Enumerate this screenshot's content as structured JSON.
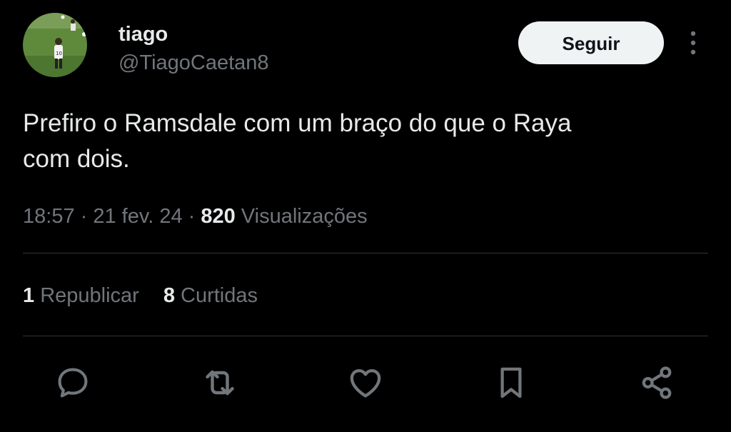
{
  "author": {
    "display_name": "tiago",
    "handle": "@TiagoCaetan8"
  },
  "follow_button": {
    "label": "Seguir"
  },
  "tweet": {
    "text_line1": "Prefiro o Ramsdale com um braço do que o Raya",
    "text_line2": "com dois."
  },
  "meta": {
    "time": "18:57",
    "separator": " · ",
    "date": "21 fev. 24",
    "views_count": "820",
    "views_label": " Visualizações"
  },
  "stats": {
    "reposts_count": "1",
    "reposts_label": " Republicar",
    "likes_count": "8",
    "likes_label": " Curtidas"
  },
  "actions": [
    {
      "icon": "reply-icon"
    },
    {
      "icon": "repost-icon"
    },
    {
      "icon": "like-icon"
    },
    {
      "icon": "bookmark-icon"
    },
    {
      "icon": "share-icon"
    }
  ],
  "colors": {
    "background": "#000000",
    "primary_text": "#e7e9ea",
    "secondary_text": "#71767b",
    "divider": "#2f3336",
    "follow_button_bg": "#eff3f4",
    "follow_button_text": "#0f1419"
  }
}
